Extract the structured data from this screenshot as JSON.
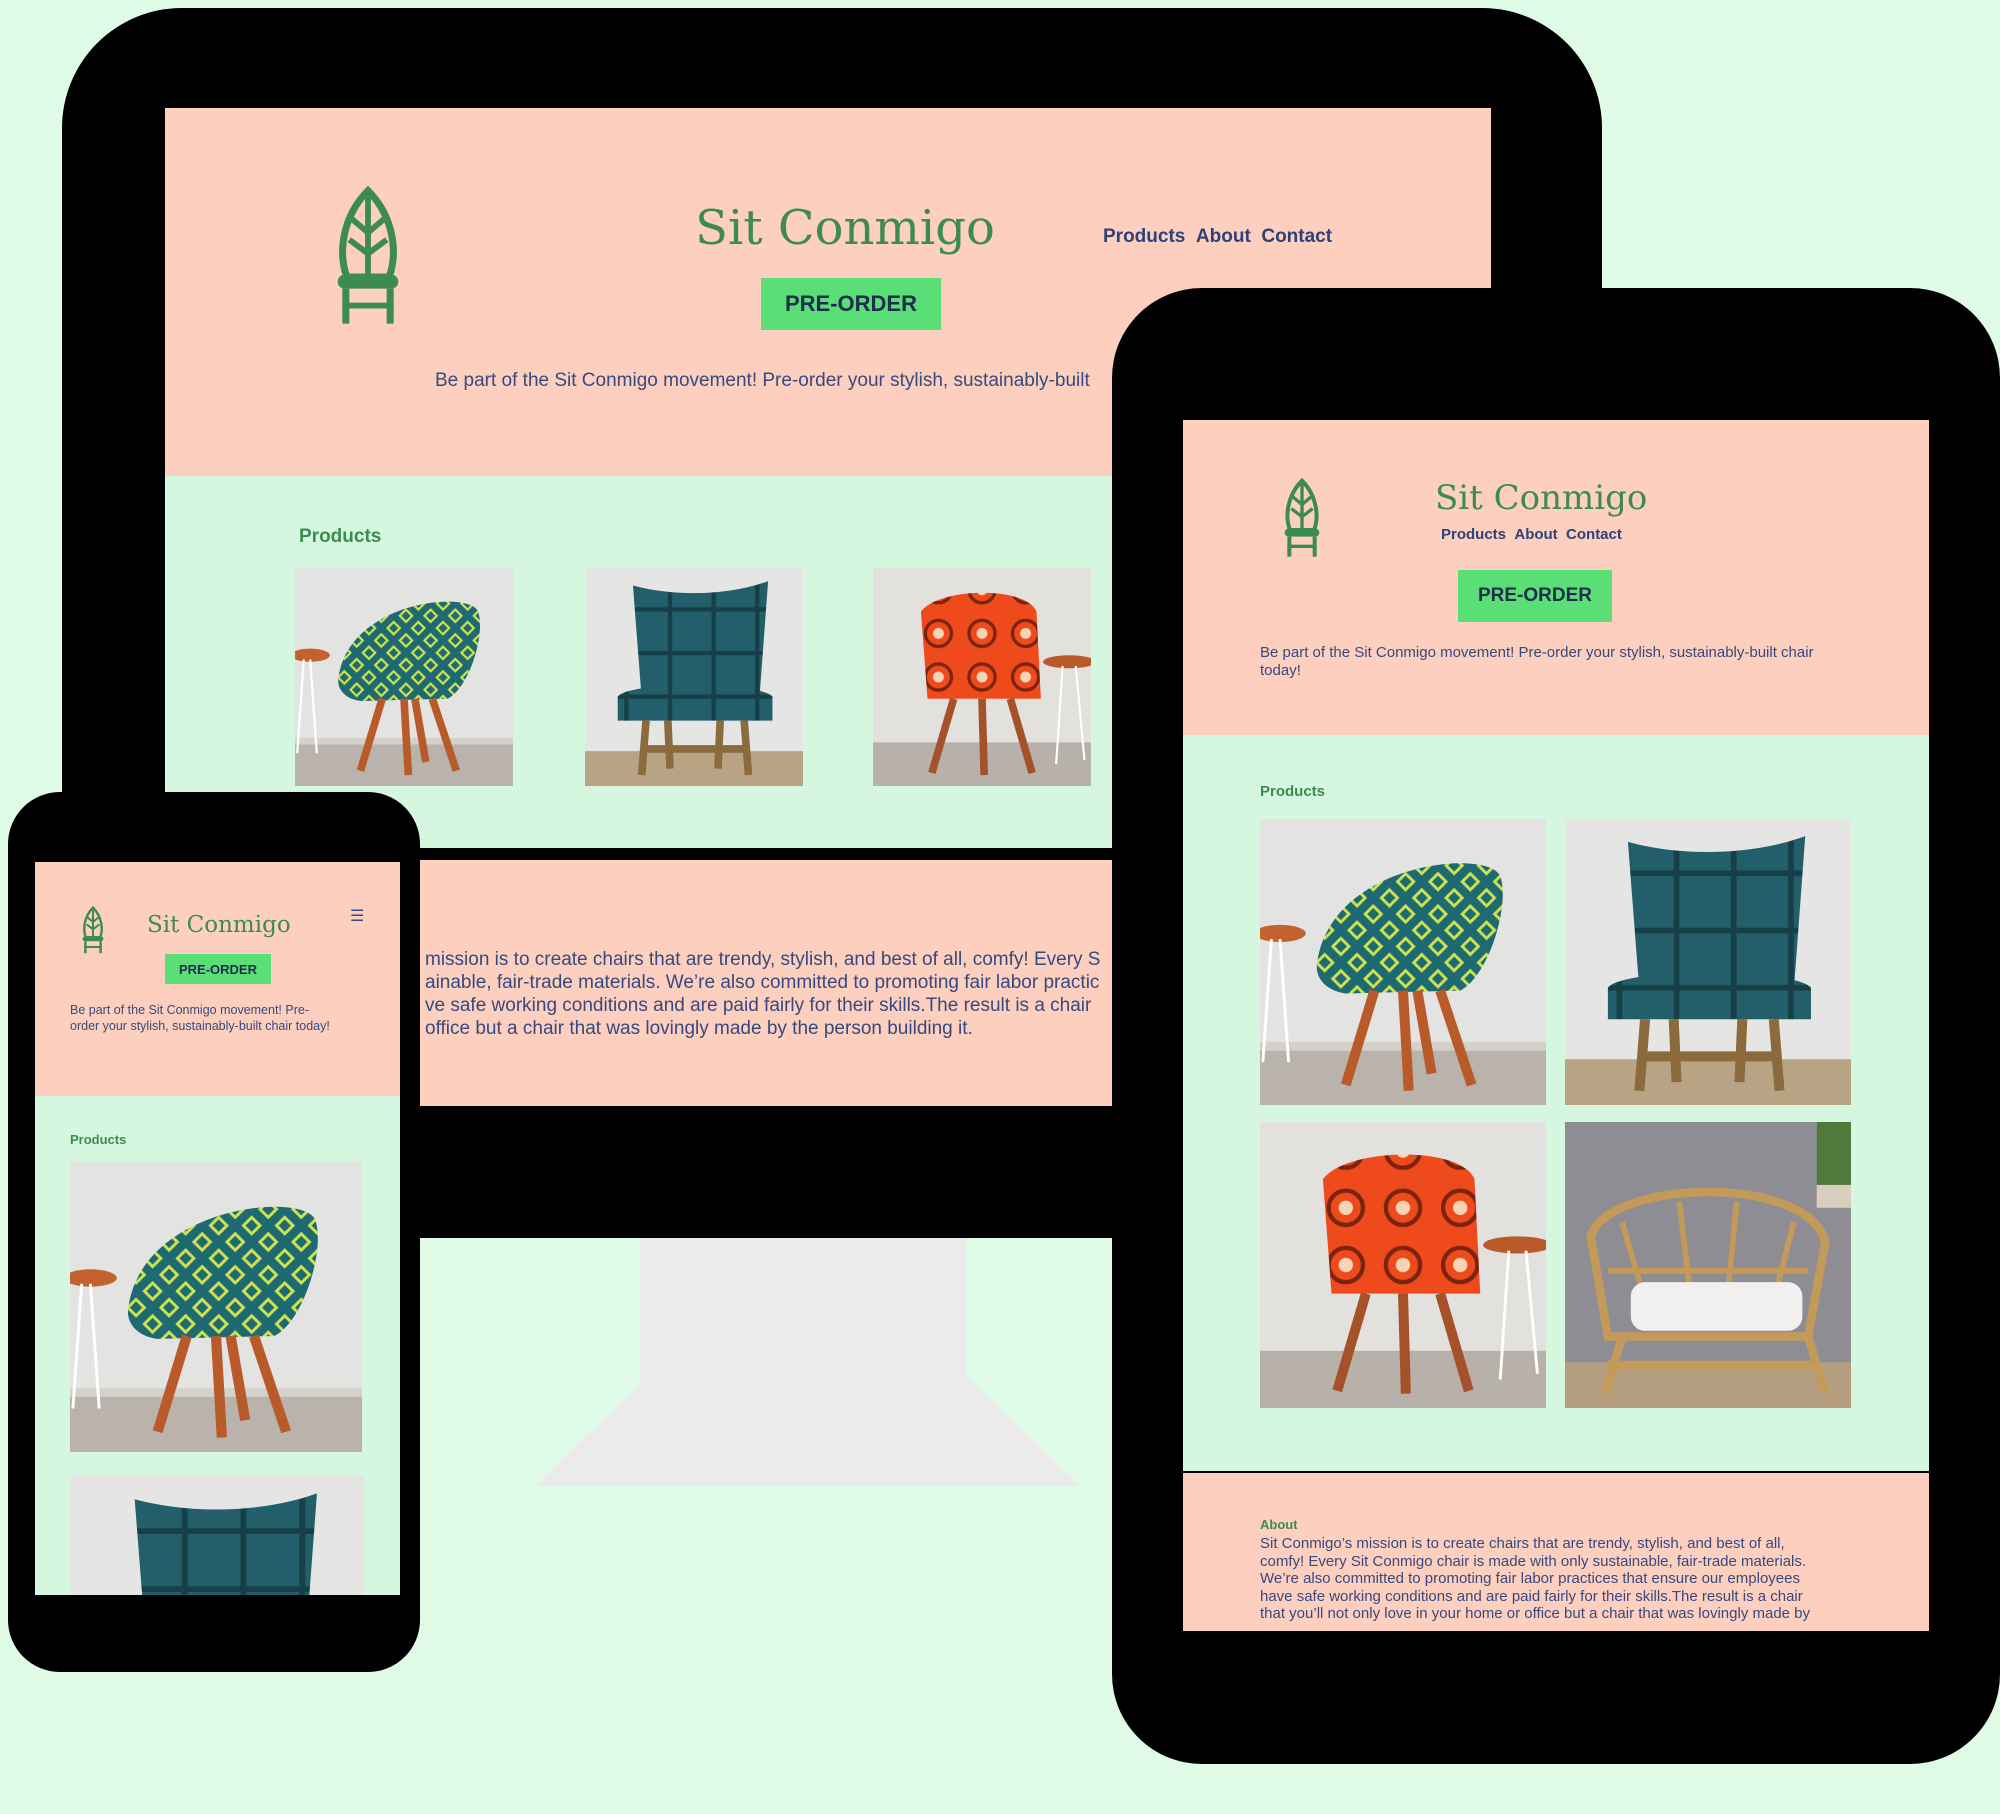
{
  "brand": {
    "name": "Sit Conmigo",
    "logo_icon": "chair-leaf-logo-icon"
  },
  "nav": {
    "products": "Products",
    "about": "About",
    "contact": "Contact"
  },
  "hero": {
    "cta": "PRE-ORDER",
    "tagline": "Be part of the Sit Conmigo movement! Pre-order your stylish, sustainably-built chair today!"
  },
  "desktop": {
    "tagline_visible": "Be part of the Sit Conmigo movement! Pre-order your stylish, sustainably-built",
    "about_lines": [
      "mission is to create chairs that are trendy, stylish, and best of all, comfy! Every S",
      "ainable, fair-trade materials. We’re also committed to promoting fair labor practic",
      "ve safe working conditions and are paid fairly for their skills.The result is a chair",
      "office but a chair that was lovingly made by the person building it."
    ]
  },
  "mobile": {
    "tagline_lines": [
      "Be part of the Sit Conmigo movement! Pre-",
      "order your stylish, sustainably-built chair today!"
    ],
    "menu_icon": "hamburger-menu-icon"
  },
  "tablet": {
    "tagline_lines": [
      "Be part of the Sit Conmigo movement! Pre-order your stylish, sustainably-built chair",
      "today!"
    ],
    "about_lines": [
      "Sit Conmigo’s mission is to create chairs that are trendy, stylish, and best of all,",
      "comfy! Every Sit Conmigo chair is made with only sustainable, fair-trade materials.",
      "We’re also committed to promoting fair labor practices that ensure our employees",
      "have safe working conditions and are paid fairly for their skills.The result is a chair",
      "that you’ll not only love in your home or office but a chair that was lovingly made by"
    ]
  },
  "products": {
    "heading": "Products",
    "items": [
      {
        "name": "teal-patterned-chair"
      },
      {
        "name": "blue-quilted-chair"
      },
      {
        "name": "orange-patterned-chair"
      },
      {
        "name": "rattan-armchair"
      }
    ]
  },
  "about": {
    "heading": "About"
  },
  "colors": {
    "page_bg": "#dffbe5",
    "header_bg": "#fccfbf",
    "section_bg": "#d6f7df",
    "accent_green": "#59df76",
    "brand_green": "#3d8c4f",
    "nav_blue": "#2e4277",
    "device_frame": "#000000",
    "monitor_stand": "#ebebeb"
  }
}
